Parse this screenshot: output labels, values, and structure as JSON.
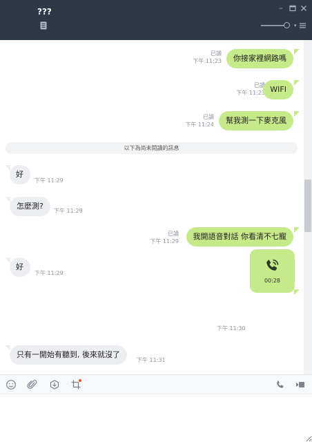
{
  "header": {
    "title": "???",
    "note_icon": "note-icon",
    "window_controls": [
      "minimize-icon",
      "maximize-icon",
      "close-icon"
    ],
    "menu_icon": "menu-icon"
  },
  "messages": [
    {
      "dir": "out",
      "text": "你接家裡網路嗎",
      "read": "已讀",
      "time": "下午 11:23"
    },
    {
      "dir": "out",
      "text": "WIFI",
      "read": "已讀",
      "time": "下午 11:23"
    },
    {
      "dir": "out",
      "text": "幫我測一下麥克風",
      "read": "已讀",
      "time": "下午 11:24"
    },
    {
      "dir": "in",
      "text": "好",
      "time": "下午 11:29"
    },
    {
      "dir": "in",
      "text": "怎麼測?",
      "time": "下午 11:29"
    },
    {
      "dir": "out",
      "text": "我開語音對話 你看清不七寵",
      "read": "已讀",
      "time": "下午 11:29"
    },
    {
      "dir": "in",
      "text": "好",
      "time": "下午 11:29"
    },
    {
      "dir": "in",
      "text": "只有一開始有聽到, 後來就沒了",
      "time": "下午 11:31"
    }
  ],
  "unread_divider": "以下為尚未閱讀的訊息",
  "call": {
    "icon": "phone-call-icon",
    "duration": "00:28",
    "time": "下午 11:30"
  },
  "toolbar": {
    "icons": [
      "emoji-icon",
      "attach-icon",
      "keep-icon",
      "crop-icon",
      "phone-icon",
      "video-icon"
    ],
    "accent": "#e8542a"
  },
  "colors": {
    "header": "#2e3847",
    "out_bubble": "#c5ea8a",
    "in_bubble": "#eceef1"
  }
}
